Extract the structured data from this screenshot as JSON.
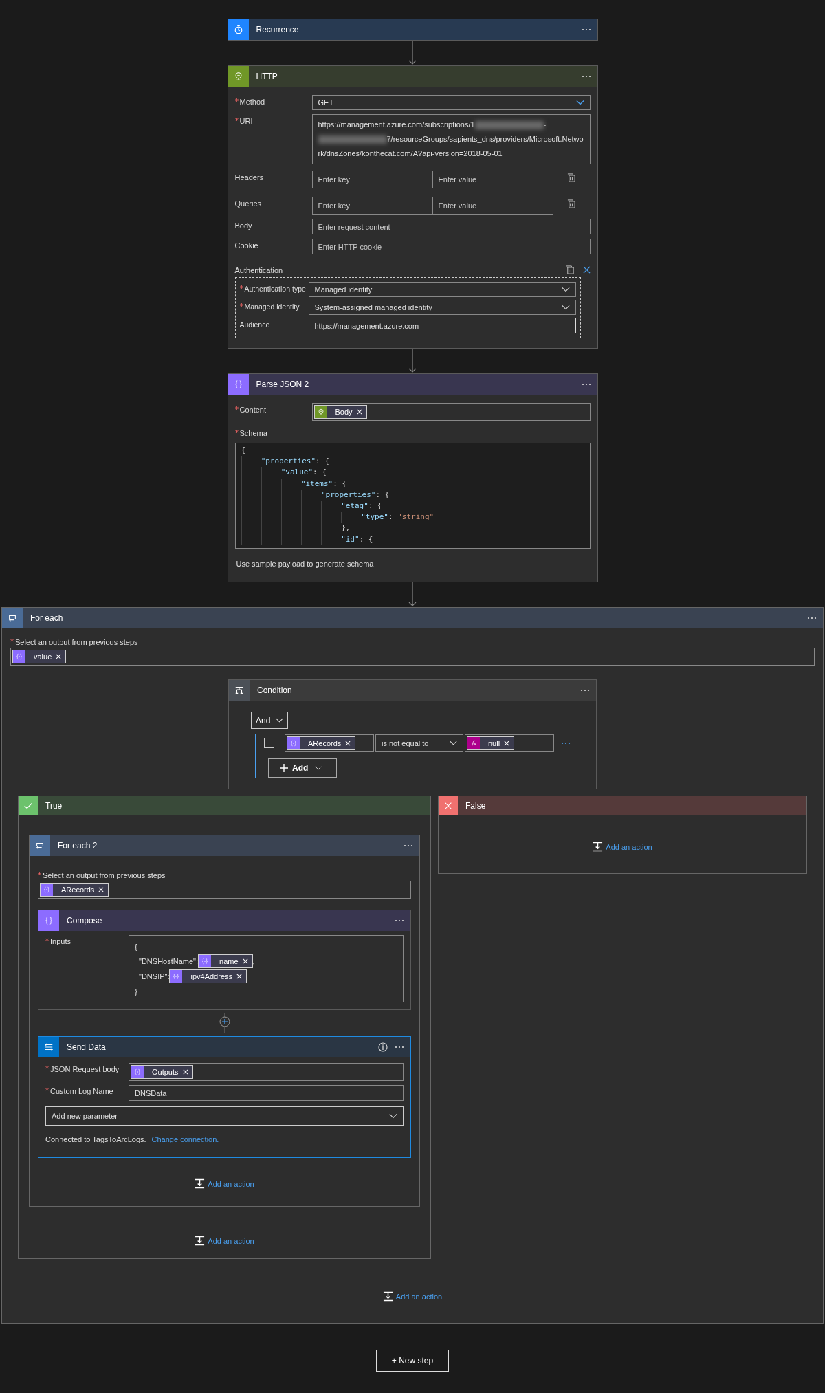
{
  "trigger": {
    "title": "Recurrence"
  },
  "http": {
    "title": "HTTP",
    "method": {
      "label": "Method",
      "required": true,
      "value": "GET"
    },
    "uri": {
      "label": "URI",
      "required": true,
      "parts": [
        {
          "kind": "text",
          "text": "https://management.azure.com/subscriptions/1"
        },
        {
          "kind": "redacted"
        },
        {
          "kind": "text",
          "text": "-"
        },
        {
          "kind": "redacted"
        },
        {
          "kind": "text",
          "text": "7/resourceGroups/sapients_dns/providers/Microsoft.Network/dnsZones/konthecat.com/A?api-version=2018-05-01"
        }
      ]
    },
    "headers": {
      "label": "Headers",
      "key_placeholder": "Enter key",
      "value_placeholder": "Enter value"
    },
    "queries": {
      "label": "Queries",
      "key_placeholder": "Enter key",
      "value_placeholder": "Enter value"
    },
    "body": {
      "label": "Body",
      "placeholder": "Enter request content"
    },
    "cookie": {
      "label": "Cookie",
      "placeholder": "Enter HTTP cookie"
    },
    "authentication": {
      "label": "Authentication",
      "fields": [
        {
          "label": "Authentication type",
          "required": true,
          "kind": "dropdown",
          "value": "Managed identity"
        },
        {
          "label": "Managed identity",
          "required": true,
          "kind": "dropdown",
          "value": "System-assigned managed identity"
        },
        {
          "label": "Audience",
          "required": false,
          "kind": "text",
          "value": "https://management.azure.com"
        }
      ]
    }
  },
  "parse_json": {
    "title": "Parse JSON 2",
    "content": {
      "label": "Content",
      "required": true,
      "tokens": [
        {
          "label": "Body",
          "kind": "http"
        }
      ]
    },
    "schema": {
      "label": "Schema",
      "required": true,
      "lines": [
        "{",
        "    \"properties\": {",
        "        \"value\": {",
        "            \"items\": {",
        "                \"properties\": {",
        "                    \"etag\": {",
        "                        \"type\": \"string\"",
        "                    },",
        "                    \"id\": {"
      ]
    },
    "hint": "Use sample payload to generate schema"
  },
  "for_each": {
    "title": "For each",
    "select": {
      "label": "Select an output from previous steps",
      "required": true,
      "tokens": [
        {
          "label": "value",
          "kind": "variable"
        }
      ]
    },
    "condition": {
      "title": "Condition",
      "operator": "And",
      "add_label": "Add",
      "rows": [
        {
          "checked": false,
          "left": [
            {
              "label": "ARecords",
              "kind": "variable"
            }
          ],
          "comparison": "is not equal to",
          "right": [
            {
              "label": "null",
              "kind": "expression"
            }
          ]
        }
      ]
    },
    "true_branch": {
      "title": "True",
      "for_each": {
        "title": "For each 2",
        "select": {
          "label": "Select an output from previous steps",
          "required": true,
          "tokens": [
            {
              "label": "ARecords",
              "kind": "variable"
            }
          ]
        },
        "compose": {
          "title": "Compose",
          "inputs": {
            "label": "Inputs",
            "required": true,
            "lines": [
              [
                {
                  "kind": "text",
                  "text": "{"
                }
              ],
              [
                {
                  "kind": "text",
                  "text": "\"DNSHostName\":"
                },
                {
                  "kind": "token",
                  "token": {
                    "label": "name",
                    "kind": "variable"
                  }
                },
                {
                  "kind": "text",
                  "text": ","
                }
              ],
              [
                {
                  "kind": "text",
                  "text": "\"DNSIP\":"
                },
                {
                  "kind": "token",
                  "token": {
                    "label": "ipv4Address",
                    "kind": "variable"
                  }
                }
              ],
              [
                {
                  "kind": "text",
                  "text": "}"
                }
              ]
            ]
          }
        },
        "send_data": {
          "title": "Send Data",
          "selected": true,
          "fields": [
            {
              "label": "JSON Request body",
              "required": true,
              "tokens": [
                {
                  "label": "Outputs",
                  "kind": "variable"
                }
              ]
            },
            {
              "label": "Custom Log Name",
              "required": true,
              "value": "DNSData"
            }
          ],
          "add_parameter": "Add new parameter",
          "connection_text": "Connected to TagsToArcLogs.",
          "connection_link": "Change connection."
        },
        "add_action": "Add an action"
      },
      "add_action": "Add an action"
    },
    "false_branch": {
      "title": "False",
      "add_action": "Add an action"
    },
    "add_action": "Add an action"
  },
  "new_step": "+ New step"
}
